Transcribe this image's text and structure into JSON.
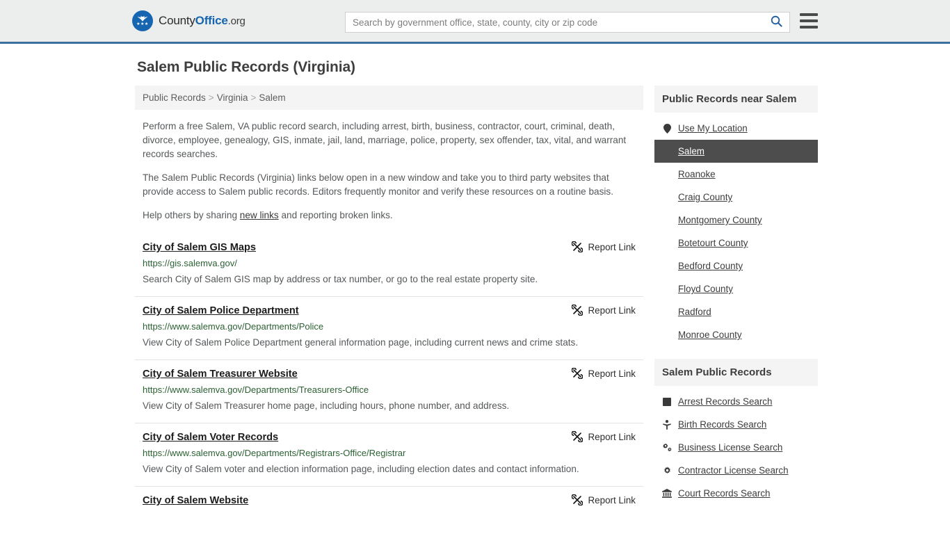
{
  "header": {
    "brand": {
      "part1": "County",
      "part2": "Office",
      "part3": ".org",
      "logo_icon": "eagle-seal-icon",
      "stars": "★★★"
    },
    "search": {
      "placeholder": "Search by government office, state, county, city or zip code",
      "value": "",
      "search_icon": "search-icon"
    },
    "menu_icon": "hamburger-menu-icon",
    "accent_color": "#3b6f9e"
  },
  "page": {
    "title": "Salem Public Records (Virginia)"
  },
  "breadcrumb": {
    "items": [
      "Public Records",
      "Virginia",
      "Salem"
    ],
    "separator": ">"
  },
  "intro": {
    "p1": "Perform a free Salem, VA public record search, including arrest, birth, business, contractor, court, criminal, death, divorce, employee, genealogy, GIS, inmate, jail, land, marriage, police, property, sex offender, tax, vital, and warrant records searches.",
    "p2": "The Salem Public Records (Virginia) links below open in a new window and take you to third party websites that provide access to Salem public records. Editors frequently monitor and verify these resources on a routine basis.",
    "p3_before": "Help others by sharing ",
    "p3_link": "new links",
    "p3_after": " and reporting broken links."
  },
  "records": {
    "report_label": "Report Link",
    "report_icon": "broken-link-icon",
    "items": [
      {
        "title": "City of Salem GIS Maps",
        "url": "https://gis.salemva.gov/",
        "description": "Search City of Salem GIS map by address or tax number, or go to the real estate property site."
      },
      {
        "title": "City of Salem Police Department",
        "url": "https://www.salemva.gov/Departments/Police",
        "description": "View City of Salem Police Department general information page, including current news and crime stats."
      },
      {
        "title": "City of Salem Treasurer Website",
        "url": "https://www.salemva.gov/Departments/Treasurers-Office",
        "description": "View City of Salem Treasurer home page, including hours, phone number, and address."
      },
      {
        "title": "City of Salem Voter Records",
        "url": "https://www.salemva.gov/Departments/Registrars-Office/Registrar",
        "description": "View City of Salem voter and election information page, including election dates and contact information."
      },
      {
        "title": "City of Salem Website",
        "url": "",
        "description": ""
      }
    ]
  },
  "sidebar": {
    "near": {
      "heading": "Public Records near Salem",
      "items": [
        {
          "label": "Use My Location",
          "icon": "map-pin-icon",
          "active": false
        },
        {
          "label": "Salem",
          "icon": "",
          "active": true
        },
        {
          "label": "Roanoke",
          "icon": "",
          "active": false
        },
        {
          "label": "Craig County",
          "icon": "",
          "active": false
        },
        {
          "label": "Montgomery County",
          "icon": "",
          "active": false
        },
        {
          "label": "Botetourt County",
          "icon": "",
          "active": false
        },
        {
          "label": "Bedford County",
          "icon": "",
          "active": false
        },
        {
          "label": "Floyd County",
          "icon": "",
          "active": false
        },
        {
          "label": "Radford",
          "icon": "",
          "active": false
        },
        {
          "label": "Monroe County",
          "icon": "",
          "active": false
        }
      ]
    },
    "records": {
      "heading": "Salem Public Records",
      "items": [
        {
          "label": "Arrest Records Search",
          "icon": "square-icon"
        },
        {
          "label": "Birth Records Search",
          "icon": "baby-icon"
        },
        {
          "label": "Business License Search",
          "icon": "cogs-icon"
        },
        {
          "label": "Contractor License Search",
          "icon": "gear-icon"
        },
        {
          "label": "Court Records Search",
          "icon": "bank-icon"
        }
      ]
    }
  }
}
